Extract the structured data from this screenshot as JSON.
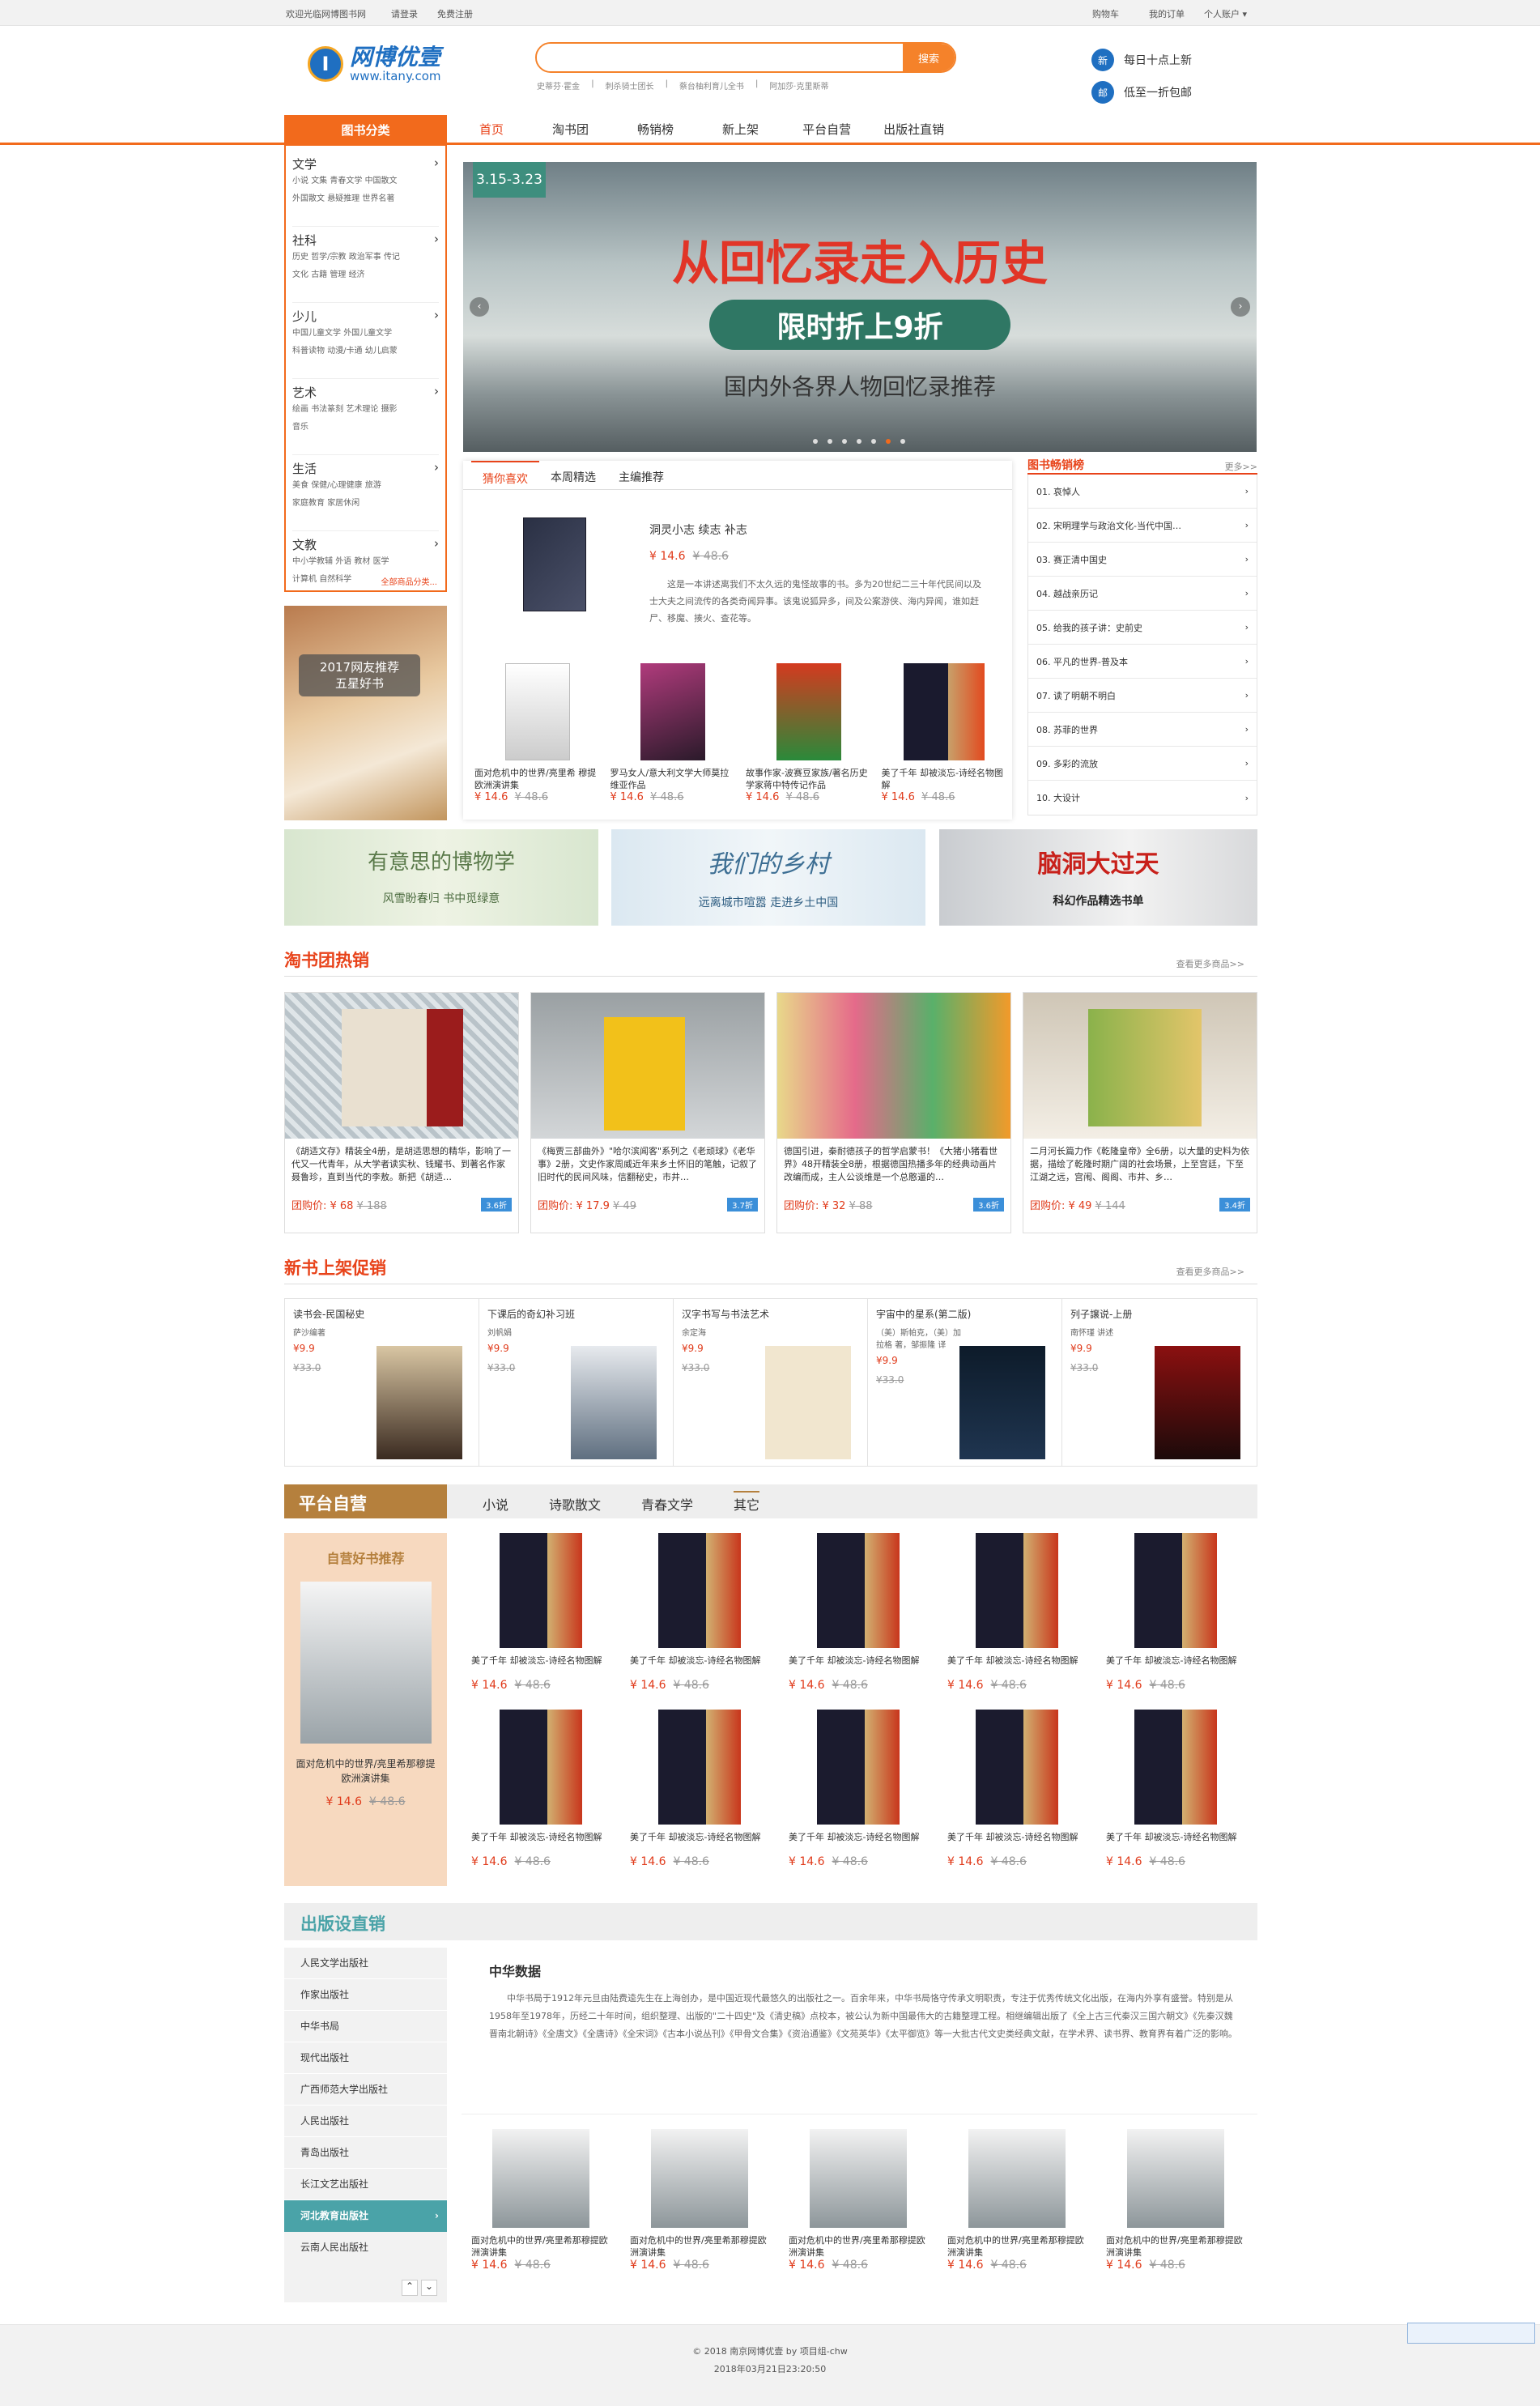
{
  "topbar": {
    "welcome": "欢迎光临网博图书网",
    "login": "请登录",
    "register": "免费注册",
    "cart": "购物车",
    "orders": "我的订单",
    "account": "个人账户"
  },
  "logo": {
    "name": "网博优壹",
    "url": "www.itany.com"
  },
  "search": {
    "placeholder": "",
    "button": "搜索",
    "hot": [
      "史蒂芬·霍金",
      "刺杀骑士团长",
      "蔡台柚利育儿全书",
      "阿加莎·克里斯蒂"
    ]
  },
  "promos": [
    {
      "badge": "新",
      "text": "每日十点上新"
    },
    {
      "badge": "邮",
      "text": "低至一折包邮"
    }
  ],
  "nav": {
    "category_btn": "图书分类",
    "items": [
      "首页",
      "淘书团",
      "畅销榜",
      "新上架",
      "平台自营",
      "出版社直销"
    ]
  },
  "categories": [
    {
      "title": "文学",
      "links": [
        "小说",
        "文集",
        "青春文学",
        "中国散文",
        "外国散文",
        "悬疑推理",
        "世界名著"
      ]
    },
    {
      "title": "社科",
      "links": [
        "历史",
        "哲学/宗教",
        "政治军事",
        "传记",
        "文化",
        "古籍",
        "管理",
        "经济"
      ]
    },
    {
      "title": "少儿",
      "links": [
        "中国儿童文学",
        "外国儿童文学",
        "科普读物",
        "动漫/卡通",
        "幼儿启蒙"
      ]
    },
    {
      "title": "艺术",
      "links": [
        "绘画",
        "书法篆刻",
        "艺术理论",
        "摄影",
        "音乐"
      ]
    },
    {
      "title": "生活",
      "links": [
        "美食",
        "保健/心理健康",
        "旅游",
        "家庭教育",
        "家居休闲"
      ]
    },
    {
      "title": "文教",
      "links": [
        "中小学教辅",
        "外语",
        "教材",
        "医学",
        "计算机",
        "自然科学"
      ]
    }
  ],
  "all_categories": "全部商品分类...",
  "side_ad": {
    "line1": "2017网友推荐",
    "line2": "五星好书"
  },
  "banner": {
    "date": "3.15-3.23",
    "title": "从回忆录走入历史",
    "sub": "限时折上9折",
    "desc": "国内外各界人物回忆录推荐",
    "dots": 7
  },
  "guess": {
    "tabs": [
      "猜你喜欢",
      "本周精选",
      "主编推荐"
    ],
    "feature": {
      "title": "洞灵小志 续志 补志",
      "price": "¥ 14.6",
      "old": "¥ 48.6",
      "desc": "这是一本讲述离我们不太久远的鬼怪故事的书。多为20世纪二三十年代民间以及士大夫之间流传的各类奇闻异事。该鬼说狐异多，间及公案游侠、海内异闻，谁如赶尸、移魔、揍火、查花等。"
    },
    "items": [
      {
        "title": "面对危机中的世界/亮里希 穆提欧洲演讲集",
        "price": "¥ 14.6",
        "old": "¥ 48.6"
      },
      {
        "title": "罗马女人/意大利文学大师莫拉维亚作品",
        "price": "¥ 14.6",
        "old": "¥ 48.6"
      },
      {
        "title": "故事作家-波赛豆家族/著名历史学家蒋中特传记作品",
        "price": "¥ 14.6",
        "old": "¥ 48.6"
      },
      {
        "title": "美了千年 却被淡忘-诗经名物图解",
        "price": "¥ 14.6",
        "old": "¥ 48.6"
      }
    ]
  },
  "bestseller": {
    "title": "图书畅销榜",
    "more": "更多>>",
    "items": [
      "01. 哀悼人",
      "02. 宋明理学与政治文化-当代中国…",
      "03. 赛正清中国史",
      "04. 越战亲历记",
      "05. 给我的孩子讲：史前史",
      "06. 平凡的世界-普及本",
      "07. 读了明朝不明白",
      "08. 苏菲的世界",
      "09. 多彩的流放",
      "10. 大设计"
    ]
  },
  "triple_banners": [
    {
      "title": "有意思的博物学",
      "sub": "风雪盼春归 书中觅绿意"
    },
    {
      "title": "我们的乡村",
      "sub": "远离城市喧嚣 走进乡土中国"
    },
    {
      "title": "脑洞大过天",
      "sub": "科幻作品精选书单"
    }
  ],
  "group": {
    "title": "淘书团热销",
    "more": "查看更多商品>>",
    "items": [
      {
        "desc": "《胡适文存》精装全4册，是胡适思想的精华，影响了一代又一代青年，从大学者读实秋、钱耀书、到著名作家聂鲁珍，直到当代的李敖。新把《胡适…",
        "price": "团购价: ¥ 68",
        "old": "¥ 188",
        "disc": "3.6折"
      },
      {
        "desc": "《梅贾三部曲外》\"哈尔滨闻客\"系列之《老顽球》《老华事》2册，文史作家周威近年来乡土怀旧的笔触，记叙了旧时代的民间风味，信翻秘史，市井…",
        "price": "团购价: ¥ 17.9",
        "old": "¥ 49",
        "disc": "3.7折"
      },
      {
        "desc": "德国引进，秦耐德孩子的哲学启蒙书！《大猪小猪看世界》48开精装全8册，根据德国热播多年的经典动画片改编而成，主人公谈维是一个总憨逼的…",
        "price": "团购价: ¥ 32",
        "old": "¥ 88",
        "disc": "3.6折"
      },
      {
        "desc": "二月河长篇力作《乾隆皇帝》全6册，以大量的史料为依据，描绘了乾隆时期广阔的社会场景，上至宫廷，下至江湖之远，宫闱、阁阁、市井、乡…",
        "price": "团购价: ¥ 49",
        "old": "¥ 144",
        "disc": "3.4折"
      }
    ]
  },
  "newbooks": {
    "title": "新书上架促销",
    "more": "查看更多商品>>",
    "items": [
      {
        "title": "读书会-民国秘史",
        "author": "萨沙编著",
        "price": "¥9.9",
        "old": "¥33.0"
      },
      {
        "title": "下课后的奇幻补习班",
        "author": "刘帆娟",
        "price": "¥9.9",
        "old": "¥33.0"
      },
      {
        "title": "汉字书写与书法艺术",
        "author": "余定海",
        "price": "¥9.9",
        "old": "¥33.0"
      },
      {
        "title": "宇宙中的星系(第二版)",
        "author": "（美）斯帕克，（美）加拉格 著，邹振隆 译",
        "price": "¥9.9",
        "old": "¥33.0"
      },
      {
        "title": "列子譲说-上册",
        "author": "南怀瑾 讲述",
        "price": "¥9.9",
        "old": "¥33.0"
      }
    ]
  },
  "self": {
    "title": "平台自营",
    "tabs": [
      "小说",
      "诗歌散文",
      "青春文学",
      "其它"
    ],
    "rec_title": "自营好书推荐",
    "rec_book": "面对危机中的世界/亮里希那穆提欧洲演讲集",
    "rec_price": "¥ 14.6",
    "rec_old": "¥ 48.6",
    "item": {
      "title": "美了千年 却被淡忘-诗经名物图解",
      "price": "¥ 14.6",
      "old": "¥ 48.6"
    }
  },
  "publisher": {
    "title": "出版设直销",
    "list": [
      "人民文学出版社",
      "作家出版社",
      "中华书局",
      "现代出版社",
      "广西师范大学出版社",
      "人民出版社",
      "青岛出版社",
      "长江文艺出版社",
      "河北教育出版社",
      "云南人民出版社"
    ],
    "active": 8,
    "name": "中华数据",
    "desc": "中华书局于1912年元旦由陆费逵先生在上海创办，是中国近现代最悠久的出版社之一。百余年来，中华书局恪守传承文明职责，专注于优秀传统文化出版，在海内外享有盛誉。特别是从1958年至1978年，历经二十年时间，组织整理、出版的\"二十四史\"及《清史稿》点校本，被公认为新中国最伟大的古籍整理工程。相继编辑出版了《全上古三代秦汉三国六朝文》《先秦汉魏晋南北朝诗》《全唐文》《全唐诗》《全宋词》《古本小说丛刊》《甲骨文合集》《资治通鉴》《文苑英华》《太平御览》等一大批古代文史类经典文献，在学术界、读书界、教育界有着广泛的影响。",
    "item": {
      "title": "面对危机中的世界/亮里希那穆提欧洲演讲集",
      "price": "¥ 14.6",
      "old": "¥ 48.6"
    }
  },
  "footer": {
    "line1": "© 2018 南京网博优壹 by 项目组-chw",
    "line2": "2018年03月21日23:20:50"
  }
}
